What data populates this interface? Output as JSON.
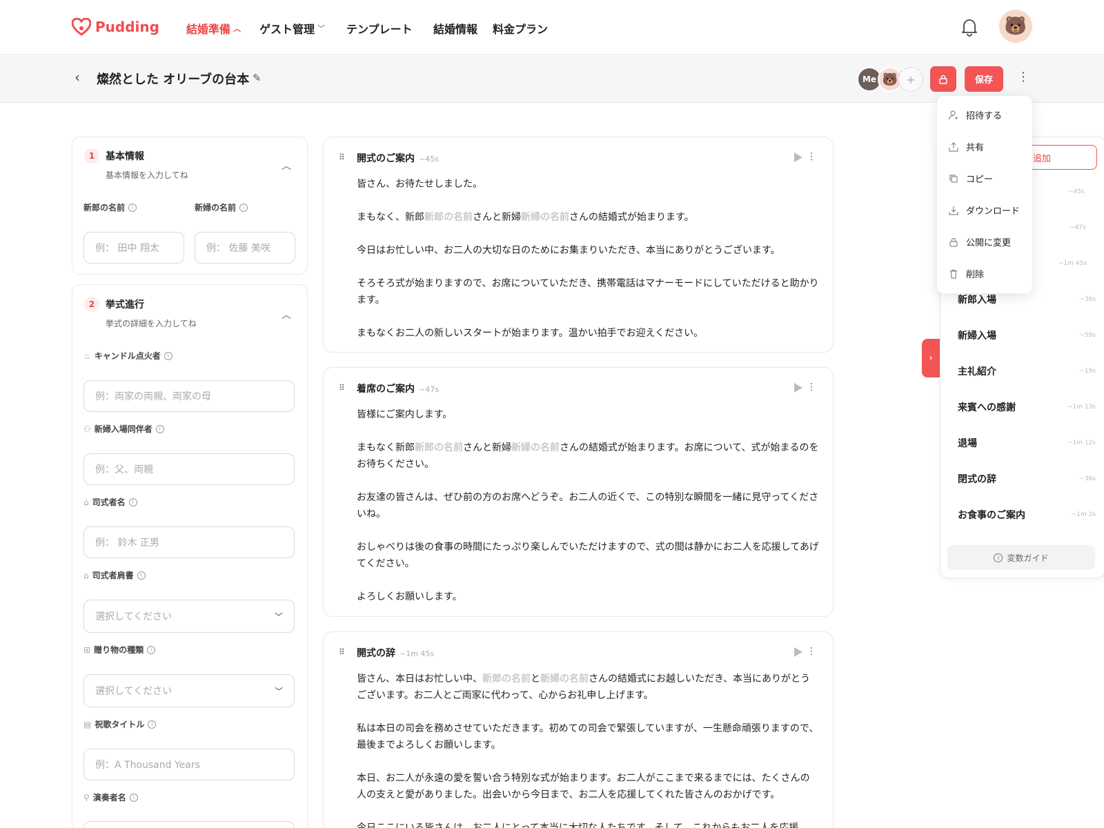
{
  "brand": {
    "name": "Pudding",
    "color": "#f04e4e"
  },
  "nav": {
    "items": [
      {
        "label": "結婚準備",
        "active": true,
        "chevron": "^"
      },
      {
        "label": "ゲスト管理",
        "active": false,
        "chevron": "v"
      },
      {
        "label": "テンプレート"
      },
      {
        "label": "結婚情報"
      },
      {
        "label": "料金プラン"
      }
    ]
  },
  "toolbar": {
    "title": "燦然とした オリーブの台本",
    "me": "Me",
    "plus": "+",
    "save": "保存"
  },
  "menu": {
    "items": [
      "招待する",
      "共有",
      "コピー",
      "ダウンロード",
      "公開に変更",
      "削除"
    ]
  },
  "form": {
    "sec1": {
      "num": "1",
      "title": "基本情報",
      "sub": "基本情報を入力してね",
      "groom_label": "新郎の名前",
      "bride_label": "新婦の名前",
      "groom_ph": "例： 田中 翔太",
      "bride_ph": "例： 佐藤 美咲"
    },
    "sec2": {
      "num": "2",
      "title": "挙式進行",
      "sub": "挙式の詳細を入力してね",
      "fields": [
        {
          "label": "キャンドル点火者",
          "ph": "例：両家の両親、両家の母"
        },
        {
          "label": "新婦入場同伴者",
          "ph": "例：父、両親"
        },
        {
          "label": "司式者名",
          "ph": "例： 鈴木 正男"
        },
        {
          "label": "司式者肩書",
          "ph": "選択してください"
        },
        {
          "label": "贈り物の種類",
          "ph": "選択してください"
        },
        {
          "label": "祝歌タイトル",
          "ph": "例：A Thousand Years"
        },
        {
          "label": "演奏者名"
        }
      ]
    }
  },
  "vars": {
    "groom": "新郎の名前",
    "bride": "新婦の名前"
  },
  "scripts": [
    {
      "title": "開式のご案内",
      "dur": "~45s",
      "p1": "皆さん、お待たせしました。",
      "p2a": "まもなく、新郎",
      "p2b": "さんと新婦",
      "p2c": "さんの結婚式が始まります。",
      "p3": "今日はお忙しい中、お二人の大切な日のためにお集まりいただき、本当にありがとうございます。",
      "p4": "そろそろ式が始まりますので、お席についていただき、携帯電話はマナーモードにしていただけると助かります。",
      "p5": "まもなくお二人の新しいスタートが始まります。温かい拍手でお迎えください。"
    },
    {
      "title": "着席のご案内",
      "dur": "~47s",
      "p1": "皆様にご案内します。",
      "p2a": "まもなく新郎",
      "p2b": "さんと新婦",
      "p2c": "さんの結婚式が始まります。お席について、式が始まるのをお待ちください。",
      "p3": "お友達の皆さんは、ぜひ前の方のお席へどうぞ。お二人の近くで、この特別な瞬間を一緒に見守ってくださいね。",
      "p4": "おしゃべりは後の食事の時間にたっぷり楽しんでいただけますので、式の間は静かにお二人を応援してあげてください。",
      "p5": "よろしくお願いします。"
    },
    {
      "title": "開式の辞",
      "dur": "~1m 45s",
      "p1a": "皆さん、本日はお忙しい中、",
      "p1b": "と",
      "p1c": "さんの結婚式にお越しいただき、本当にありがとうございます。お二人とご両家に代わって、心からお礼申し上げます。",
      "p2": "私は本日の司会を務めさせていただきます。初めての司会で緊張していますが、一生懸命頑張りますので、最後までよろしくお願いします。",
      "p3": "本日、お二人が永遠の愛を誓い合う特別な式が始まります。お二人がここまで来るまでには、たくさんの人の支えと愛がありました。出会いから今日まで、お二人を応援してくれた皆さんのおかげです。",
      "p4": "今日ここにいる皆さんは、お二人にとって本当に大切な人たちです。そして、これからもお二人を応援"
    }
  ],
  "outline": {
    "add": "追加",
    "hidden_durs": [
      "~45s",
      "~47s",
      "~1m 45s"
    ],
    "items": [
      {
        "label": "新郎入場",
        "dur": "~36s"
      },
      {
        "label": "新婦入場",
        "dur": "~59s"
      },
      {
        "label": "主礼紹介",
        "dur": "~19s"
      },
      {
        "label": "来賓への感謝",
        "dur": "~1m 13s"
      },
      {
        "label": "退場",
        "dur": "~1m 12s"
      },
      {
        "label": "閉式の辞",
        "dur": "~36s"
      },
      {
        "label": "お食事のご案内",
        "dur": "~1m 2s"
      }
    ],
    "guide": "変数ガイド"
  }
}
